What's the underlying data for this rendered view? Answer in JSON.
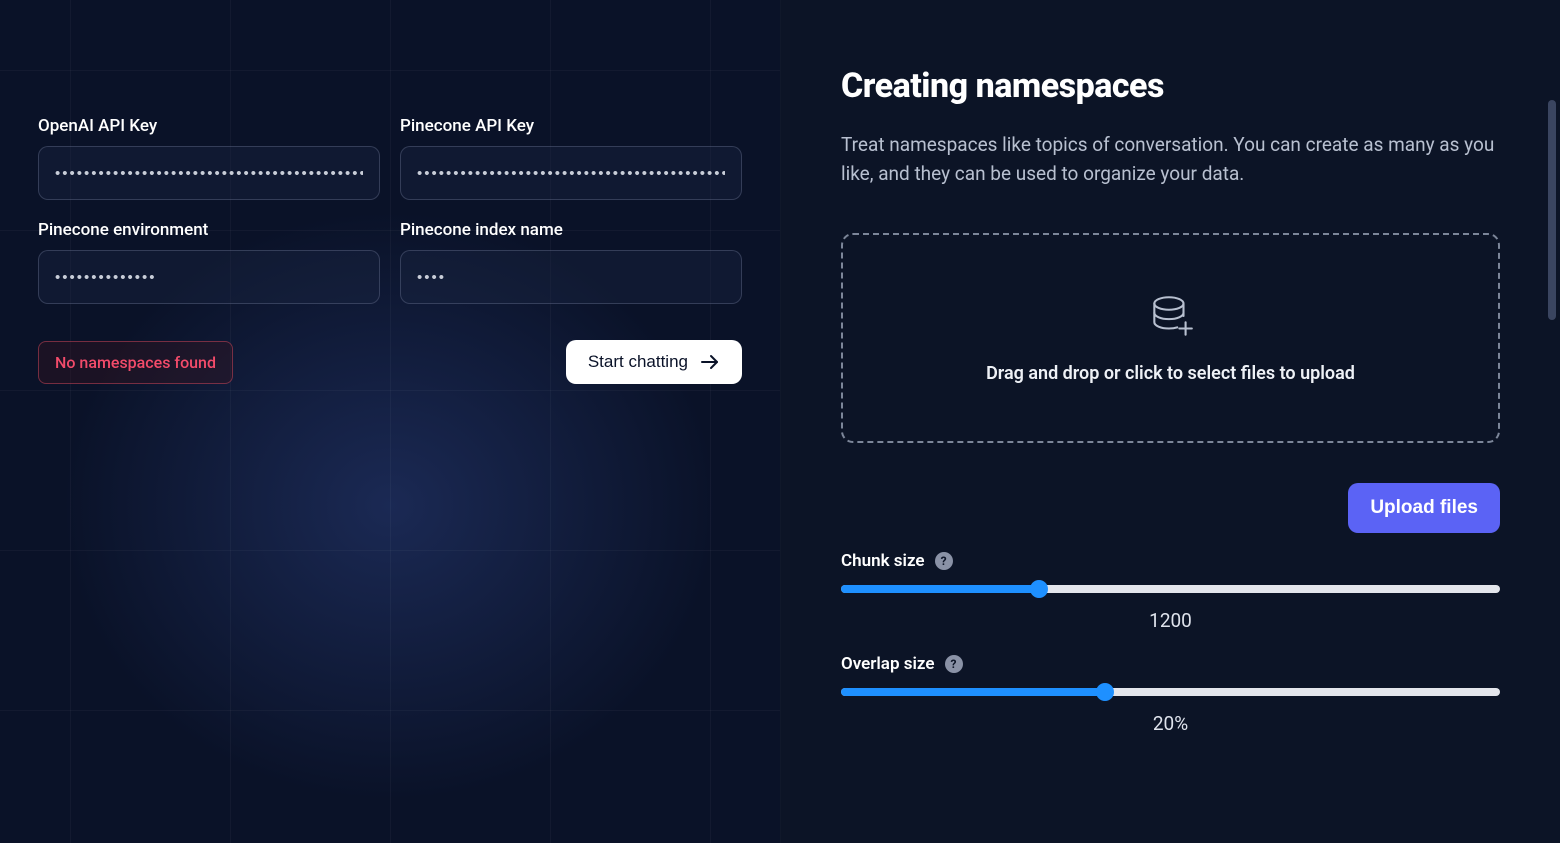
{
  "left": {
    "fields": {
      "openai_key": {
        "label": "OpenAI API Key",
        "value": "•••••••••••••••••••••••••••••••••••••••••••••••••••"
      },
      "pinecone_key": {
        "label": "Pinecone API Key",
        "value": "••••••••••••••••••••••••••••••••••••••••••••••••"
      },
      "pinecone_env": {
        "label": "Pinecone environment",
        "value": "••••••••••••••"
      },
      "pinecone_index": {
        "label": "Pinecone index name",
        "value": "••••"
      }
    },
    "error_text": "No namespaces found",
    "start_button": "Start chatting"
  },
  "right": {
    "heading": "Creating namespaces",
    "description": "Treat namespaces like topics of conversation. You can create as many as you like, and they can be used to organize your data.",
    "dropzone_text": "Drag and drop or click to select files to upload",
    "upload_button": "Upload files",
    "sliders": {
      "chunk": {
        "label": "Chunk size",
        "value_text": "1200",
        "percent": 30
      },
      "overlap": {
        "label": "Overlap size",
        "value_text": "20%",
        "percent": 40
      }
    }
  }
}
